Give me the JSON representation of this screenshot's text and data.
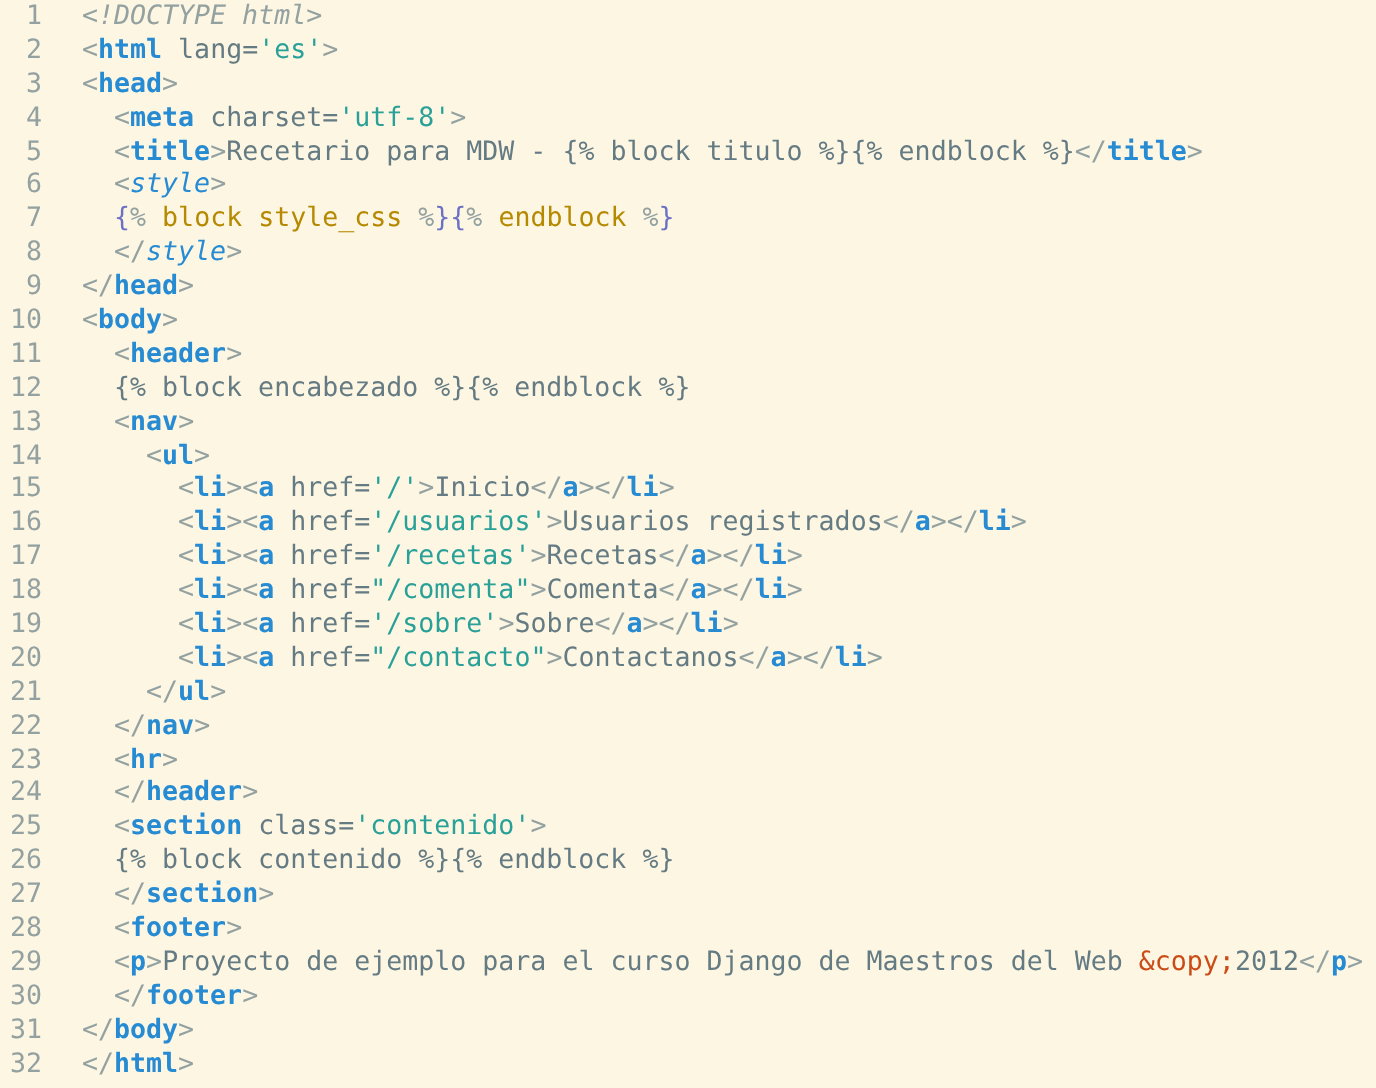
{
  "editor": {
    "lines": [
      {
        "number": "1",
        "tokens": [
          {
            "kind": "doctype",
            "text": "<!DOCTYPE html>"
          }
        ]
      },
      {
        "number": "2",
        "tokens": [
          {
            "kind": "punct",
            "text": "<"
          },
          {
            "kind": "tag",
            "text": "html"
          },
          {
            "kind": "attr",
            "text": " lang="
          },
          {
            "kind": "string",
            "text": "'es'"
          },
          {
            "kind": "punct",
            "text": ">"
          }
        ]
      },
      {
        "number": "3",
        "tokens": [
          {
            "kind": "punct",
            "text": "<"
          },
          {
            "kind": "tag",
            "text": "head"
          },
          {
            "kind": "punct",
            "text": ">"
          }
        ]
      },
      {
        "number": "4",
        "tokens": [
          {
            "kind": "punct",
            "text": "  <"
          },
          {
            "kind": "tag",
            "text": "meta"
          },
          {
            "kind": "attr",
            "text": " charset="
          },
          {
            "kind": "string",
            "text": "'utf-8'"
          },
          {
            "kind": "punct",
            "text": ">"
          }
        ]
      },
      {
        "number": "5",
        "tokens": [
          {
            "kind": "punct",
            "text": "  <"
          },
          {
            "kind": "tag",
            "text": "title"
          },
          {
            "kind": "punct",
            "text": ">"
          },
          {
            "kind": "text",
            "text": "Recetario para MDW - {% block titulo %}{% endblock %}"
          },
          {
            "kind": "punct",
            "text": "</"
          },
          {
            "kind": "tag",
            "text": "title"
          },
          {
            "kind": "punct",
            "text": ">"
          }
        ]
      },
      {
        "number": "6",
        "tokens": [
          {
            "kind": "punct",
            "text": "  <"
          },
          {
            "kind": "styletag",
            "text": "style"
          },
          {
            "kind": "punct",
            "text": ">"
          }
        ]
      },
      {
        "number": "7",
        "tokens": [
          {
            "kind": "brace",
            "text": "  {"
          },
          {
            "kind": "punct",
            "text": "%"
          },
          {
            "kind": "template",
            "text": " block style_css "
          },
          {
            "kind": "punct",
            "text": "%"
          },
          {
            "kind": "brace",
            "text": "}{"
          },
          {
            "kind": "punct",
            "text": "%"
          },
          {
            "kind": "template",
            "text": " endblock "
          },
          {
            "kind": "punct",
            "text": "%"
          },
          {
            "kind": "brace",
            "text": "}"
          }
        ]
      },
      {
        "number": "8",
        "tokens": [
          {
            "kind": "punct",
            "text": "  </"
          },
          {
            "kind": "styletag",
            "text": "style"
          },
          {
            "kind": "punct",
            "text": ">"
          }
        ]
      },
      {
        "number": "9",
        "tokens": [
          {
            "kind": "punct",
            "text": "</"
          },
          {
            "kind": "tag",
            "text": "head"
          },
          {
            "kind": "punct",
            "text": ">"
          }
        ]
      },
      {
        "number": "10",
        "tokens": [
          {
            "kind": "punct",
            "text": "<"
          },
          {
            "kind": "tag",
            "text": "body"
          },
          {
            "kind": "punct",
            "text": ">"
          }
        ]
      },
      {
        "number": "11",
        "tokens": [
          {
            "kind": "punct",
            "text": "  <"
          },
          {
            "kind": "tag",
            "text": "header"
          },
          {
            "kind": "punct",
            "text": ">"
          }
        ]
      },
      {
        "number": "12",
        "tokens": [
          {
            "kind": "text",
            "text": "  {% block encabezado %}{% endblock %}"
          }
        ]
      },
      {
        "number": "13",
        "tokens": [
          {
            "kind": "punct",
            "text": "  <"
          },
          {
            "kind": "tag",
            "text": "nav"
          },
          {
            "kind": "punct",
            "text": ">"
          }
        ]
      },
      {
        "number": "14",
        "tokens": [
          {
            "kind": "punct",
            "text": "    <"
          },
          {
            "kind": "tag",
            "text": "ul"
          },
          {
            "kind": "punct",
            "text": ">"
          }
        ]
      },
      {
        "number": "15",
        "tokens": [
          {
            "kind": "punct",
            "text": "      <"
          },
          {
            "kind": "tag",
            "text": "li"
          },
          {
            "kind": "punct",
            "text": "><"
          },
          {
            "kind": "tag",
            "text": "a"
          },
          {
            "kind": "attr",
            "text": " href="
          },
          {
            "kind": "string",
            "text": "'/'"
          },
          {
            "kind": "punct",
            "text": ">"
          },
          {
            "kind": "text",
            "text": "Inicio"
          },
          {
            "kind": "punct",
            "text": "</"
          },
          {
            "kind": "tag",
            "text": "a"
          },
          {
            "kind": "punct",
            "text": "></"
          },
          {
            "kind": "tag",
            "text": "li"
          },
          {
            "kind": "punct",
            "text": ">"
          }
        ]
      },
      {
        "number": "16",
        "tokens": [
          {
            "kind": "punct",
            "text": "      <"
          },
          {
            "kind": "tag",
            "text": "li"
          },
          {
            "kind": "punct",
            "text": "><"
          },
          {
            "kind": "tag",
            "text": "a"
          },
          {
            "kind": "attr",
            "text": " href="
          },
          {
            "kind": "string",
            "text": "'/usuarios'"
          },
          {
            "kind": "punct",
            "text": ">"
          },
          {
            "kind": "text",
            "text": "Usuarios registrados"
          },
          {
            "kind": "punct",
            "text": "</"
          },
          {
            "kind": "tag",
            "text": "a"
          },
          {
            "kind": "punct",
            "text": "></"
          },
          {
            "kind": "tag",
            "text": "li"
          },
          {
            "kind": "punct",
            "text": ">"
          }
        ]
      },
      {
        "number": "17",
        "tokens": [
          {
            "kind": "punct",
            "text": "      <"
          },
          {
            "kind": "tag",
            "text": "li"
          },
          {
            "kind": "punct",
            "text": "><"
          },
          {
            "kind": "tag",
            "text": "a"
          },
          {
            "kind": "attr",
            "text": " href="
          },
          {
            "kind": "string",
            "text": "'/recetas'"
          },
          {
            "kind": "punct",
            "text": ">"
          },
          {
            "kind": "text",
            "text": "Recetas"
          },
          {
            "kind": "punct",
            "text": "</"
          },
          {
            "kind": "tag",
            "text": "a"
          },
          {
            "kind": "punct",
            "text": "></"
          },
          {
            "kind": "tag",
            "text": "li"
          },
          {
            "kind": "punct",
            "text": ">"
          }
        ]
      },
      {
        "number": "18",
        "tokens": [
          {
            "kind": "punct",
            "text": "      <"
          },
          {
            "kind": "tag",
            "text": "li"
          },
          {
            "kind": "punct",
            "text": "><"
          },
          {
            "kind": "tag",
            "text": "a"
          },
          {
            "kind": "attr",
            "text": " href="
          },
          {
            "kind": "string",
            "text": "\"/comenta\""
          },
          {
            "kind": "punct",
            "text": ">"
          },
          {
            "kind": "text",
            "text": "Comenta"
          },
          {
            "kind": "punct",
            "text": "</"
          },
          {
            "kind": "tag",
            "text": "a"
          },
          {
            "kind": "punct",
            "text": "></"
          },
          {
            "kind": "tag",
            "text": "li"
          },
          {
            "kind": "punct",
            "text": ">"
          }
        ]
      },
      {
        "number": "19",
        "tokens": [
          {
            "kind": "punct",
            "text": "      <"
          },
          {
            "kind": "tag",
            "text": "li"
          },
          {
            "kind": "punct",
            "text": "><"
          },
          {
            "kind": "tag",
            "text": "a"
          },
          {
            "kind": "attr",
            "text": " href="
          },
          {
            "kind": "string",
            "text": "'/sobre'"
          },
          {
            "kind": "punct",
            "text": ">"
          },
          {
            "kind": "text",
            "text": "Sobre"
          },
          {
            "kind": "punct",
            "text": "</"
          },
          {
            "kind": "tag",
            "text": "a"
          },
          {
            "kind": "punct",
            "text": "></"
          },
          {
            "kind": "tag",
            "text": "li"
          },
          {
            "kind": "punct",
            "text": ">"
          }
        ]
      },
      {
        "number": "20",
        "tokens": [
          {
            "kind": "punct",
            "text": "      <"
          },
          {
            "kind": "tag",
            "text": "li"
          },
          {
            "kind": "punct",
            "text": "><"
          },
          {
            "kind": "tag",
            "text": "a"
          },
          {
            "kind": "attr",
            "text": " href="
          },
          {
            "kind": "string",
            "text": "\"/contacto\""
          },
          {
            "kind": "punct",
            "text": ">"
          },
          {
            "kind": "text",
            "text": "Contactanos"
          },
          {
            "kind": "punct",
            "text": "</"
          },
          {
            "kind": "tag",
            "text": "a"
          },
          {
            "kind": "punct",
            "text": "></"
          },
          {
            "kind": "tag",
            "text": "li"
          },
          {
            "kind": "punct",
            "text": ">"
          }
        ]
      },
      {
        "number": "21",
        "tokens": [
          {
            "kind": "punct",
            "text": "    </"
          },
          {
            "kind": "tag",
            "text": "ul"
          },
          {
            "kind": "punct",
            "text": ">"
          }
        ]
      },
      {
        "number": "22",
        "tokens": [
          {
            "kind": "punct",
            "text": "  </"
          },
          {
            "kind": "tag",
            "text": "nav"
          },
          {
            "kind": "punct",
            "text": ">"
          }
        ]
      },
      {
        "number": "23",
        "tokens": [
          {
            "kind": "punct",
            "text": "  <"
          },
          {
            "kind": "tag",
            "text": "hr"
          },
          {
            "kind": "punct",
            "text": ">"
          }
        ]
      },
      {
        "number": "24",
        "tokens": [
          {
            "kind": "punct",
            "text": "  </"
          },
          {
            "kind": "tag",
            "text": "header"
          },
          {
            "kind": "punct",
            "text": ">"
          }
        ]
      },
      {
        "number": "25",
        "tokens": [
          {
            "kind": "punct",
            "text": "  <"
          },
          {
            "kind": "tag",
            "text": "section"
          },
          {
            "kind": "attr",
            "text": " class="
          },
          {
            "kind": "string",
            "text": "'contenido'"
          },
          {
            "kind": "punct",
            "text": ">"
          }
        ]
      },
      {
        "number": "26",
        "tokens": [
          {
            "kind": "text",
            "text": "  {% block contenido %}{% endblock %}"
          }
        ]
      },
      {
        "number": "27",
        "tokens": [
          {
            "kind": "punct",
            "text": "  </"
          },
          {
            "kind": "tag",
            "text": "section"
          },
          {
            "kind": "punct",
            "text": ">"
          }
        ]
      },
      {
        "number": "28",
        "tokens": [
          {
            "kind": "punct",
            "text": "  <"
          },
          {
            "kind": "tag",
            "text": "footer"
          },
          {
            "kind": "punct",
            "text": ">"
          }
        ]
      },
      {
        "number": "29",
        "tokens": [
          {
            "kind": "punct",
            "text": "  <"
          },
          {
            "kind": "tag",
            "text": "p"
          },
          {
            "kind": "punct",
            "text": ">"
          },
          {
            "kind": "text",
            "text": "Proyecto de ejemplo para el curso Django de Maestros del Web "
          },
          {
            "kind": "entity",
            "text": "&copy;"
          },
          {
            "kind": "text",
            "text": "2012"
          },
          {
            "kind": "punct",
            "text": "</"
          },
          {
            "kind": "tag",
            "text": "p"
          },
          {
            "kind": "punct",
            "text": ">"
          }
        ]
      },
      {
        "number": "30",
        "tokens": [
          {
            "kind": "punct",
            "text": "  </"
          },
          {
            "kind": "tag",
            "text": "footer"
          },
          {
            "kind": "punct",
            "text": ">"
          }
        ]
      },
      {
        "number": "31",
        "tokens": [
          {
            "kind": "punct",
            "text": "</"
          },
          {
            "kind": "tag",
            "text": "body"
          },
          {
            "kind": "punct",
            "text": ">"
          }
        ]
      },
      {
        "number": "32",
        "tokens": [
          {
            "kind": "punct",
            "text": "</"
          },
          {
            "kind": "tag",
            "text": "html"
          },
          {
            "kind": "punct",
            "text": ">"
          }
        ]
      }
    ]
  }
}
